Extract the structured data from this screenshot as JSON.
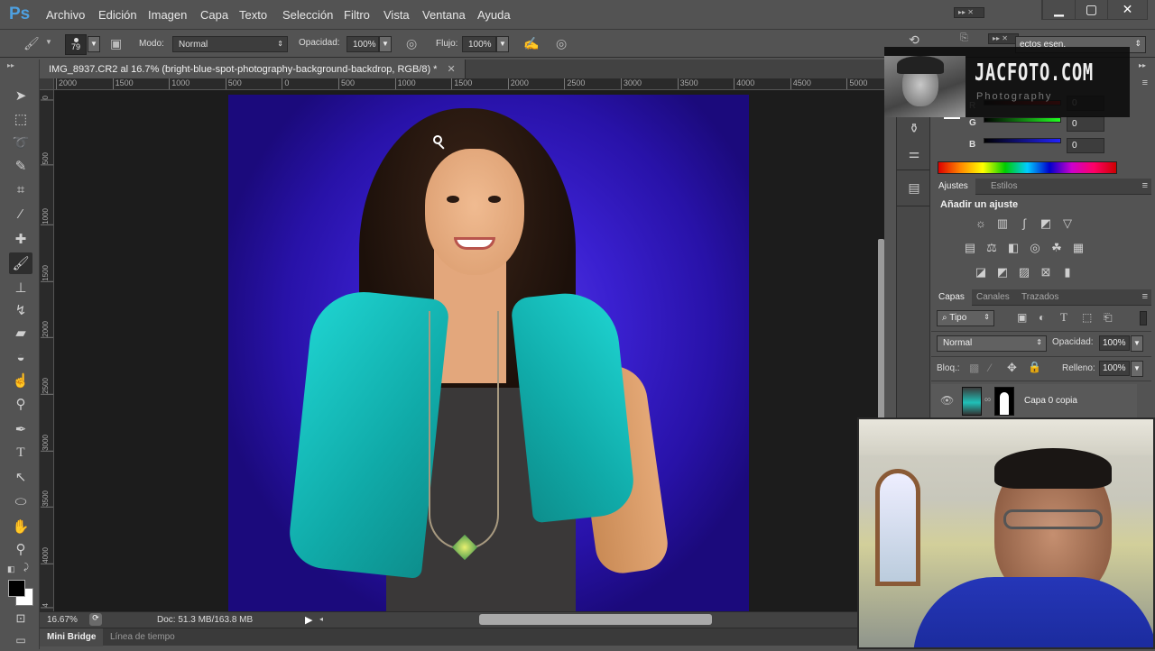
{
  "app": {
    "logo": "Ps"
  },
  "menu": [
    "Archivo",
    "Edición",
    "Imagen",
    "Capa",
    "Texto",
    "Selección",
    "Filtro",
    "Vista",
    "Ventana",
    "Ayuda"
  ],
  "window_controls": {
    "minimize": "▁",
    "maximize": "▢",
    "close": "✕"
  },
  "options_bar": {
    "brush_size": "79",
    "mode_label": "Modo:",
    "mode_value": "Normal",
    "opacity_label": "Opacidad:",
    "opacity_value": "100%",
    "flow_label": "Flujo:",
    "flow_value": "100%"
  },
  "document": {
    "tab_title": "IMG_8937.CR2 al 16.7% (bright-blue-spot-photography-background-backdrop, RGB/8) *",
    "close": "✕"
  },
  "ruler": {
    "horizontal": [
      "2000",
      "1500",
      "1000",
      "500",
      "0",
      "500",
      "1000",
      "1500",
      "2000",
      "2500",
      "3000",
      "3500",
      "4000",
      "4500",
      "5000"
    ],
    "vertical": [
      "0",
      "500",
      "1000",
      "1500",
      "2000",
      "2500",
      "3000",
      "3500",
      "4000",
      "4"
    ]
  },
  "status": {
    "zoom": "16.67%",
    "doc": "Doc: 51.3 MB/163.8 MB"
  },
  "bottom_tabs": [
    "Mini Bridge",
    "Línea de tiempo"
  ],
  "workspace_select": "ectos esen.",
  "color_panel": {
    "channels": [
      {
        "label": "R",
        "value": "0"
      },
      {
        "label": "G",
        "value": "0"
      },
      {
        "label": "B",
        "value": "0"
      }
    ]
  },
  "adjust_panel": {
    "tabs": [
      "Ajustes",
      "Estilos"
    ],
    "title": "Añadir un ajuste"
  },
  "layers_panel": {
    "tabs": [
      "Capas",
      "Canales",
      "Trazados"
    ],
    "filter_label": "Tipo",
    "blend_mode": "Normal",
    "opacity_label": "Opacidad:",
    "opacity_value": "100%",
    "lock_label": "Bloq.:",
    "fill_label": "Relleno:",
    "fill_value": "100%",
    "layers": [
      {
        "name": "Capa 0 copia",
        "visible": true
      }
    ]
  },
  "overlay": {
    "title": "JACFOTO.COM",
    "subtitle": "Photography"
  }
}
